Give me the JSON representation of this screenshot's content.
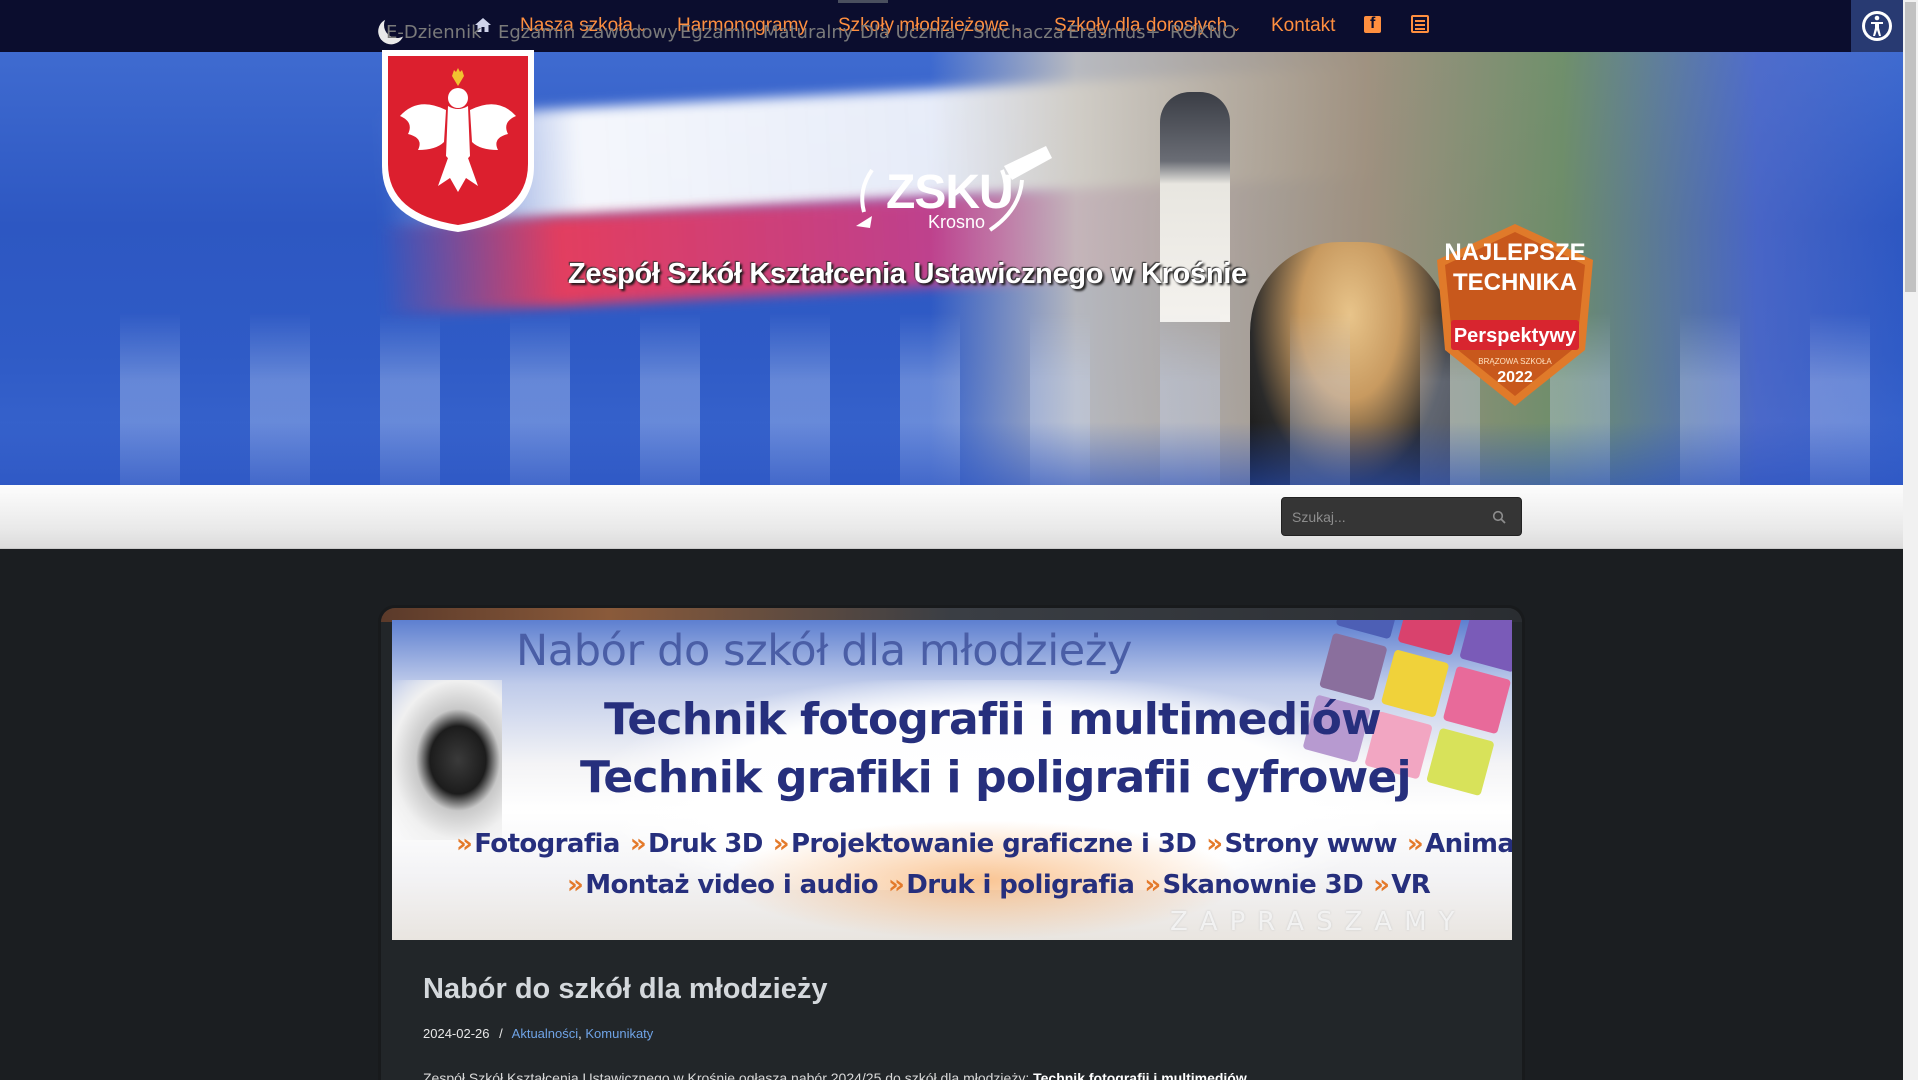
{
  "colors": {
    "topbar_bg": "#0b0d2e",
    "nav_accent": "#ff8f3f",
    "page_bg": "#1b1e21",
    "link": "#6fa3e6"
  },
  "topnav": {
    "items": [
      {
        "label": "Nasza szkoła",
        "dropdown": true
      },
      {
        "label": "Harmonogramy",
        "dropdown": false
      },
      {
        "label": "Szkoły młodzieżowe",
        "dropdown": true
      },
      {
        "label": "Szkoły dla dorosłych",
        "dropdown": true
      },
      {
        "label": "Kontakt",
        "dropdown": false
      }
    ],
    "chevron": "⌄",
    "icons": [
      "moon-icon",
      "home-icon",
      "facebook-icon",
      "newspaper-icon",
      "accessibility-icon"
    ]
  },
  "header": {
    "logo_text": "ZSKU",
    "logo_sub": "Krosno",
    "title": "Zespół Szkół Kształcenia Ustawicznego w Krośnie",
    "badge": {
      "line1": "NAJLEPSZE",
      "line2": "TECHNIKA",
      "line3": "Perspektywy",
      "line4": "BRĄZOWA SZKOŁA",
      "year": "2022"
    }
  },
  "submenu": {
    "items": [
      "E-Dziennik",
      "Egzamin Zawodowy",
      "Egzamin Maturalny",
      "Dla Ucznia / Słuchacza",
      "Erasmus+",
      "ROKNO"
    ],
    "search_placeholder": "Szukaj..."
  },
  "promo": {
    "heading": "Nabór do szkół dla młodzieży",
    "line1": "Technik fotografii i multimediów",
    "line2": "Technik grafiki i poligrafii cyfrowej",
    "row1": [
      "Fotografia",
      "Druk 3D",
      "Projektowanie graficzne i 3D",
      "Strony www",
      "Animacja"
    ],
    "row2": [
      "Montaż video i audio",
      "Druk i poligrafia",
      "Skanownie 3D",
      "VR"
    ],
    "footer": "ZAPRASZAMY"
  },
  "post": {
    "title": "Nabór do szkół dla młodzieży",
    "date": "2024-02-26",
    "separator": "/",
    "categories": [
      "Aktualności",
      "Komunikaty"
    ],
    "excerpt_start": "Zespół Szkół Kształcenia Ustawicznego w Krośnie ogłasza nabór 2024/25 do szkół dla młodzieży:",
    "excerpt_bold": "Technik fotografii i multimediów"
  }
}
